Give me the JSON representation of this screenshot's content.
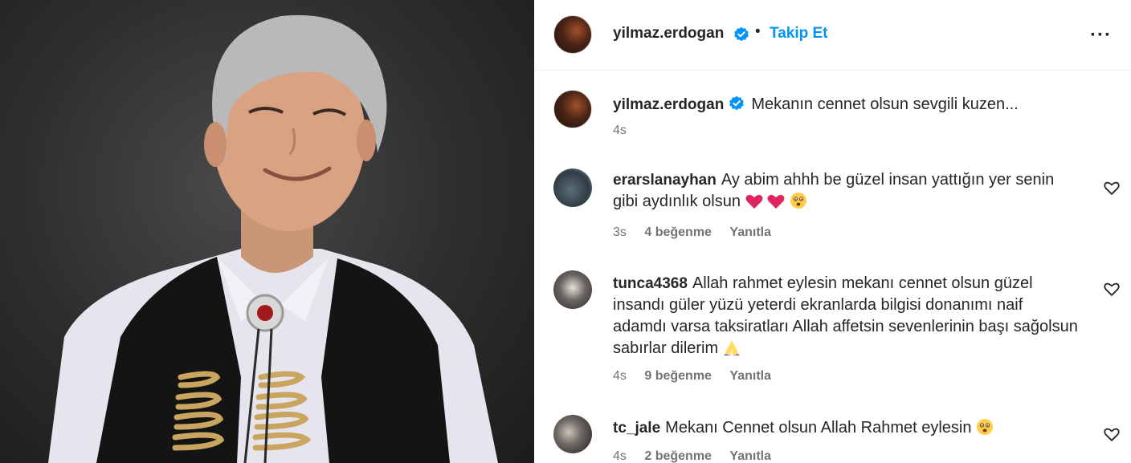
{
  "post": {
    "author": "yilmaz.erdogan",
    "follow_label": "Takip Et",
    "separator": "•",
    "more_label": "···",
    "caption": "Mekanın cennet olsun sevgili kuzen...",
    "caption_time": "4s"
  },
  "comments": [
    {
      "username": "erarslanayhan",
      "text": "Ay abim ahhh be güzel insan yattığın yer senin gibi aydınlık olsun",
      "emojis": [
        "red-heart",
        "red-heart",
        "sad-face"
      ],
      "time": "3s",
      "likes": "4 beğenme",
      "reply_label": "Yanıtla"
    },
    {
      "username": "tunca4368",
      "text": "Allah rahmet eylesin mekanı cennet olsun güzel insandı güler yüzü yeterdi ekranlarda bilgisi donanımı naif adamdı varsa taksiratları Allah affetsin sevenlerinin başı sağolsun sabırlar dilerim",
      "emojis": [
        "praying-hands"
      ],
      "time": "4s",
      "likes": "9 beğenme",
      "reply_label": "Yanıtla"
    },
    {
      "username": "tc_jale",
      "text": "Mekanı Cennet olsun Allah Rahmet eylesin",
      "emojis": [
        "sad-face"
      ],
      "time": "4s",
      "likes": "2 beğenme",
      "reply_label": "Yanıtla"
    }
  ],
  "colors": {
    "accent": "#0095f6",
    "verified": "#0095f6",
    "text": "#262626",
    "muted": "#737373",
    "emoji_heart": "#e0245e"
  }
}
